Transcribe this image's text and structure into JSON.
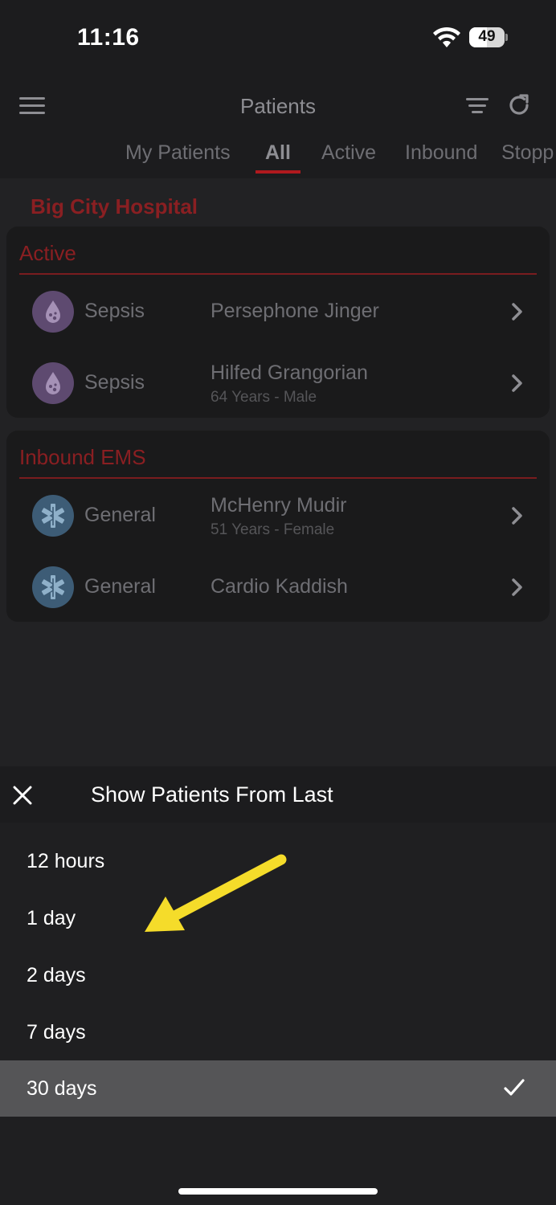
{
  "status_bar": {
    "time": "11:16",
    "battery_percent": "49"
  },
  "nav": {
    "title": "Patients"
  },
  "tabs": [
    {
      "label": "My Patients"
    },
    {
      "label": "All"
    },
    {
      "label": "Active"
    },
    {
      "label": "Inbound"
    },
    {
      "label": "Stopp"
    }
  ],
  "selected_tab": "All",
  "hospital": {
    "name": "Big City Hospital"
  },
  "sections": [
    {
      "title": "Active",
      "patients": [
        {
          "category": "Sepsis",
          "icon": "blood-drop-icon",
          "name": "Persephone Jinger",
          "detail": ""
        },
        {
          "category": "Sepsis",
          "icon": "blood-drop-icon",
          "name": "Hilfed Grangorian",
          "detail": "64 Years - Male"
        }
      ]
    },
    {
      "title": "Inbound EMS",
      "patients": [
        {
          "category": "General",
          "icon": "star-of-life-icon",
          "name": "McHenry Mudir",
          "detail": "51 Years - Female"
        },
        {
          "category": "General",
          "icon": "star-of-life-icon",
          "name": "Cardio Kaddish",
          "detail": ""
        }
      ]
    }
  ],
  "sheet": {
    "title": "Show Patients From Last",
    "options": [
      {
        "label": "12 hours"
      },
      {
        "label": "1 day"
      },
      {
        "label": "2 days"
      },
      {
        "label": "7 days"
      },
      {
        "label": "30 days"
      }
    ],
    "selected_option": "30 days"
  },
  "colors": {
    "accent_red": "#b0191e",
    "sepsis_purple": "#5e4a70",
    "general_blue": "#3d5c76",
    "annotation_yellow": "#f5dc2a"
  }
}
